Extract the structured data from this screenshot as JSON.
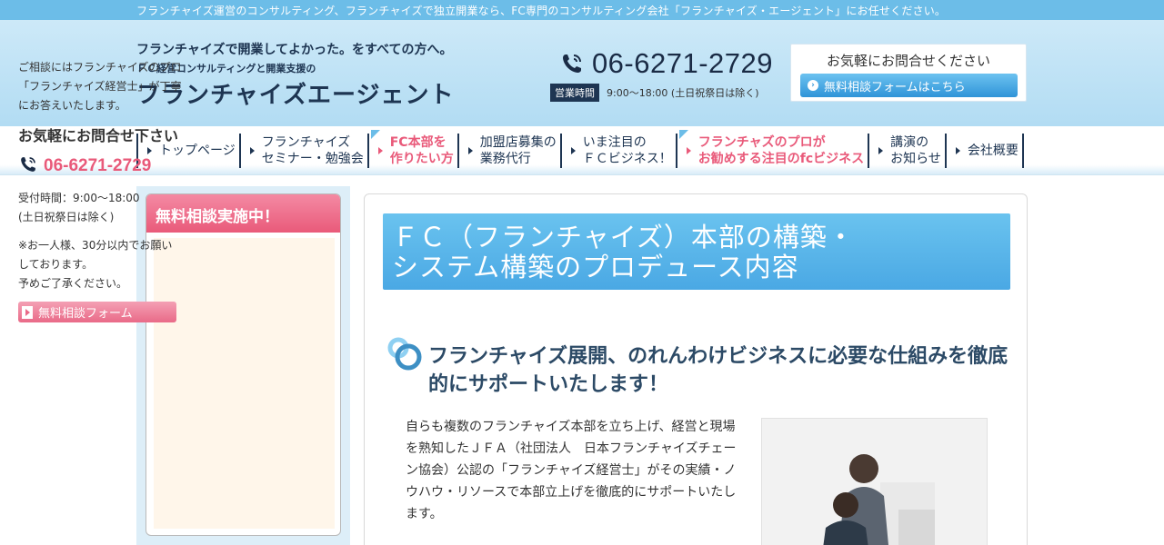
{
  "topbar": {
    "text": "フランチャイズ運営のコンサルティング、フランチャイズで独立開業なら、FC専門のコンサルティング会社「フランチャイズ・エージェント」にお任せください。"
  },
  "header": {
    "logo": {
      "tagline1": "フランチャイズで開業してよかった。をすべての方へ。",
      "tagline2": "ＦＣ経営コンサルティングと開業支援の",
      "name": "フランチャイズエージェント"
    },
    "phone": "06-6271-2729",
    "hours_badge": "営業時間",
    "hours_text": "9:00〜18:00 (土日祝祭日は除く)",
    "contact_title": "お気軽にお問合せください",
    "contact_button": "無料相談フォームはこちら"
  },
  "nav": {
    "items": [
      {
        "label": "トップページ",
        "style": "normal"
      },
      {
        "label": "フランチャイズ\nセミナー・勉強会",
        "style": "normal"
      },
      {
        "label": "FC本部を\n作りたい方",
        "style": "pink"
      },
      {
        "label": "加盟店募集の\n業務代行",
        "style": "normal"
      },
      {
        "label": "いま注目の\nＦＣビジネス！",
        "style": "normal"
      },
      {
        "label": "フランチャズのプロが\nお勧めする注目のfcビジネス",
        "style": "pink"
      },
      {
        "label": "講演の\nお知らせ",
        "style": "normal"
      },
      {
        "label": "会社概要",
        "style": "normal"
      }
    ]
  },
  "sidebar": {
    "heading": "無料相談実施中！",
    "intro": "ご相談にはフランチャイズのプロ「フランチャイズ経営士」が丁寧にお答えいたします。",
    "call_label": "お気軽にお問合せ下さい",
    "phone": "06-6271-2729",
    "hours_line1": "受付時間：9:00〜18:00",
    "hours_line2": "(土日祝祭日は除く)",
    "note": "※お一人様、30分以内でお願いしております。\n予めご了承ください。",
    "form_button": "無料相談フォーム"
  },
  "main": {
    "title": "ＦＣ（フランチャイズ）本部の構築・\nシステム構築のプロデュース内容",
    "section_heading": "フランチャイズ展開、のれんわけビジネスに必要な仕組みを徹底的にサポートいたします！",
    "body": "自らも複数のフランチャイズ本部を立ち上げ、経営と現場を熟知したＪＦＡ（社団法人　日本フランチャイズチェーン協会）公認の「フランチャイズ経営士」がその実績・ノウハウ・リソースで本部立上げを徹底的にサポートいたします。"
  },
  "colors": {
    "brand_navy": "#1e3552",
    "accent_blue": "#4aa8e4",
    "accent_pink": "#e95a7a"
  },
  "icons": {
    "phone": "phone-icon",
    "arrow": "arrow-right-icon",
    "rings": "rings-icon"
  }
}
